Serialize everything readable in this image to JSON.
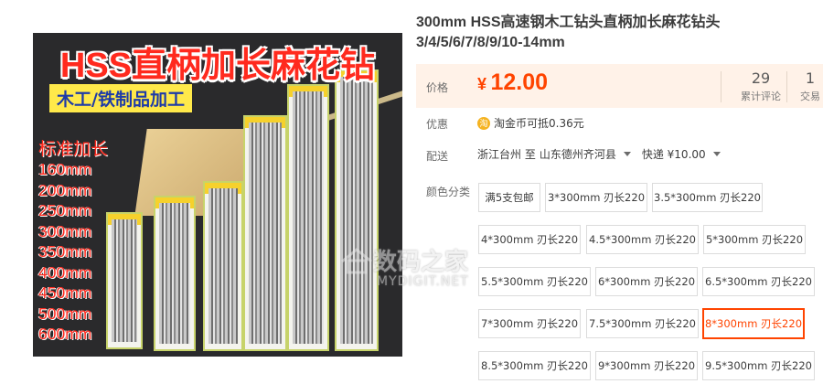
{
  "image": {
    "title": "HSS直柄加长麻花钻",
    "subtitle": "木工/铁制品加工",
    "sizes_title": "标准加长",
    "sizes": [
      "160mm",
      "200mm",
      "250mm",
      "300mm",
      "350mm",
      "400mm",
      "450mm",
      "500mm",
      "600mm"
    ]
  },
  "watermark": {
    "text": "数码之家",
    "sub": "MYDIGIT.NET"
  },
  "product": {
    "title": "300mm HSS高速钢木工钻头直柄加长麻花钻头3/4/5/6/7/8/9/10-14mm",
    "price_label": "价格",
    "price_symbol": "¥",
    "price_value": "12.00",
    "reviews_count": "29",
    "reviews_label": "累计评论",
    "trades_count": "1",
    "trades_label": "交易",
    "promo_label": "优惠",
    "promo_icon": "淘",
    "promo_text": "淘金币可抵0.36元",
    "delivery_label": "配送",
    "delivery_from": "浙江台州 至",
    "delivery_to": "山东德州齐河县",
    "delivery_method": "快递 ¥10.00",
    "sku_label": "颜色分类",
    "options": [
      "满5支包邮",
      "3*300mm 刃长220",
      "3.5*300mm 刃长220",
      "4*300mm 刃长220",
      "4.5*300mm 刃长220",
      "5*300mm 刃长220",
      "5.5*300mm 刃长220",
      "6*300mm 刃长220",
      "6.5*300mm 刃长220",
      "7*300mm 刃长220",
      "7.5*300mm 刃长220",
      "8*300mm 刃长220",
      "8.5*300mm 刃长220",
      "9*300mm 刃长220",
      "9.5*300mm 刃长220"
    ],
    "selected_option": "8*300mm 刃长220"
  },
  "colors": {
    "price": "#ff4400",
    "price_bg": "#fff2e8",
    "selected_border": "#ff4400"
  }
}
